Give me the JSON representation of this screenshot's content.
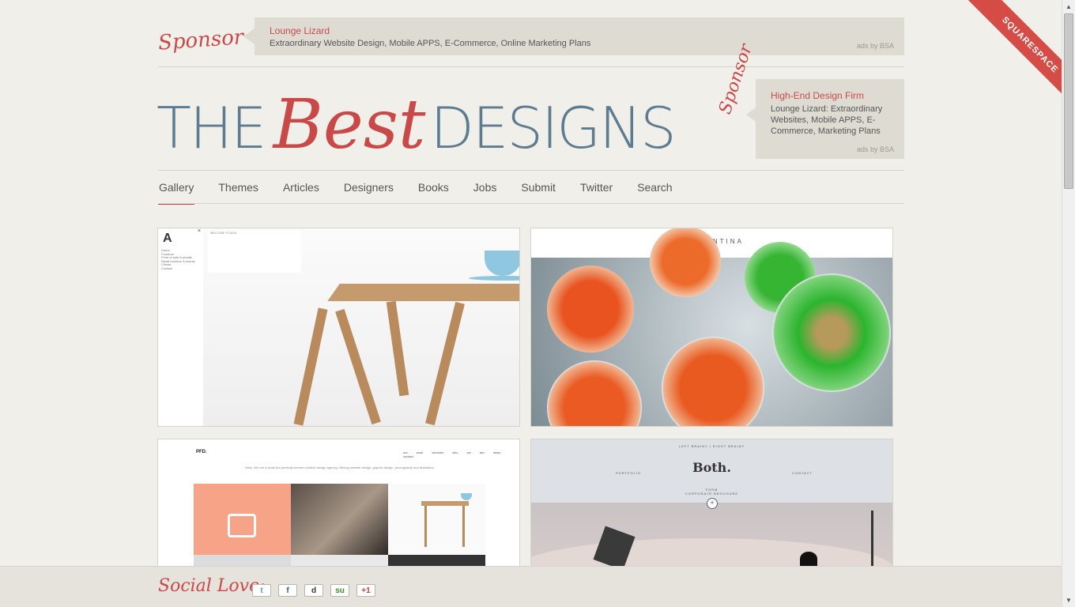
{
  "sponsor_top": {
    "label": "Sponsor",
    "title": "Lounge Lizard",
    "description": "Extraordinary Website Design, Mobile APPS, E-Commerce, Online Marketing Plans",
    "ads_by": "ads by BSA"
  },
  "logo": {
    "the": "THE",
    "best": "Best",
    "designs": "DESIGNS"
  },
  "sponsor_right": {
    "label": "Sponsor",
    "title": "High-End Design Firm",
    "description": "Lounge Lizard: Extraordinary Websites, Mobile APPS, E-Commerce, Marketing Plans",
    "ads_by": "ads by BSA"
  },
  "nav": {
    "items": [
      "Gallery",
      "Themes",
      "Articles",
      "Designers",
      "Books",
      "Jobs",
      "Submit",
      "Twitter",
      "Search"
    ],
    "active": "Gallery"
  },
  "gallery": {
    "thumb1": {
      "logo": "A",
      "close": "×",
      "menu": "Home\nFurniture\nPoint of sale & private\nRetail furniture & events\nClients\nContact",
      "intro": "WELCOME TO AGGI"
    },
    "thumb2": {
      "title": "FLORENTINA"
    },
    "thumb3": {
      "logo": "PFD.",
      "nav": "our work services who we are news contact",
      "tagline": "Hello. We are a small but perfectly formed creative design agency, offering website design, graphic design, photography and illustration."
    },
    "thumb4": {
      "tagline": "LEFT BRAINY | RIGHT BRAINY",
      "logo": "Both.",
      "portfolio": "PORTFOLIO",
      "contact": "CONTACT",
      "subtitle": "FORM\nCORPORATE BROCHURE"
    }
  },
  "social": {
    "label": "Social Love:",
    "buttons": [
      {
        "icon": "twitter-icon",
        "glyph": "t"
      },
      {
        "icon": "facebook-icon",
        "glyph": "f"
      },
      {
        "icon": "digg-icon",
        "glyph": "d"
      },
      {
        "icon": "stumbleupon-icon",
        "glyph": "su"
      },
      {
        "icon": "google-plus-icon",
        "glyph": "+1"
      }
    ]
  },
  "ribbon": {
    "label": "SQUARESPACE"
  },
  "colors": {
    "accent": "#c94949",
    "logo_blue": "#5d7c91",
    "background": "#f1efe9",
    "ad_box": "#dedcd2"
  }
}
